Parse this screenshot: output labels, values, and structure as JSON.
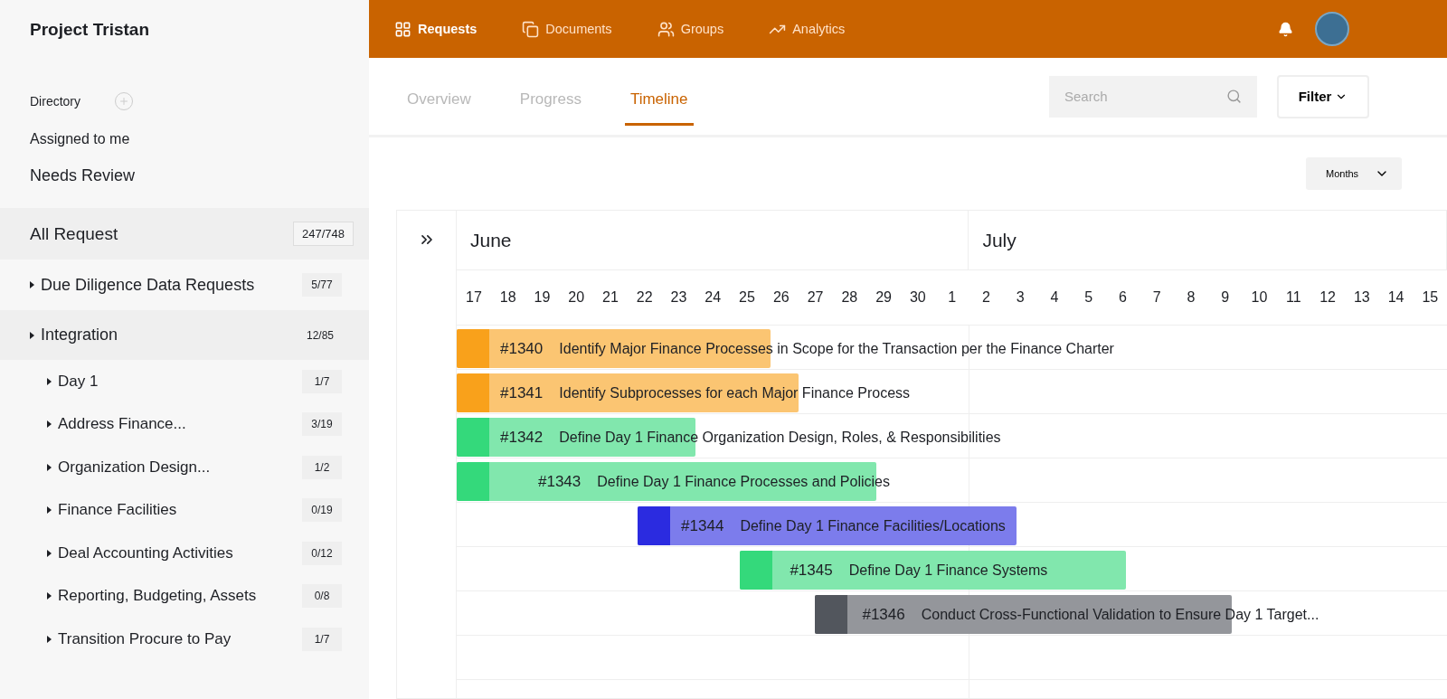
{
  "sidebar": {
    "title": "Project Tristan",
    "links": [
      {
        "label": "Directory",
        "kind": "section"
      },
      {
        "label": "Assigned to me",
        "kind": "link"
      },
      {
        "label": "Needs Review",
        "kind": "link-large"
      }
    ],
    "all_requests": {
      "label": "All Request",
      "count": "247/748"
    },
    "groups": [
      {
        "label": "Due Diligence Data Requests",
        "count": "5/77",
        "selected": false
      },
      {
        "label": "Integration",
        "count": "12/85",
        "selected": true,
        "children": [
          {
            "label": "Day 1",
            "count": "1/7"
          },
          {
            "label": "Address Finance...",
            "count": "3/19"
          },
          {
            "label": "Organization Design...",
            "count": "1/2"
          },
          {
            "label": "Finance Facilities",
            "count": "0/19"
          },
          {
            "label": "Deal Accounting Activities",
            "count": "0/12"
          },
          {
            "label": "Reporting, Budgeting, Assets",
            "count": "0/8"
          },
          {
            "label": "Transition Procure to Pay",
            "count": "1/7"
          }
        ]
      }
    ]
  },
  "top_nav": {
    "items": [
      {
        "label": "Requests",
        "selected": true
      },
      {
        "label": "Documents",
        "selected": false
      },
      {
        "label": "Groups",
        "selected": false
      },
      {
        "label": "Analytics",
        "selected": false
      }
    ]
  },
  "tabs": [
    {
      "label": "Overview",
      "selected": false
    },
    {
      "label": "Progress",
      "selected": false
    },
    {
      "label": "Timeline",
      "selected": true
    }
  ],
  "search": {
    "placeholder": "Search"
  },
  "filter_button": "Filter",
  "scale_select": "Months",
  "timeline": {
    "months": [
      {
        "name": "June",
        "days": [
          "17",
          "18",
          "19",
          "20",
          "21",
          "22",
          "23",
          "24",
          "25",
          "26",
          "27",
          "28",
          "29",
          "30",
          "1"
        ]
      },
      {
        "name": "July",
        "days": [
          "2",
          "3",
          "4",
          "5",
          "6",
          "7",
          "8",
          "9",
          "10",
          "11",
          "12",
          "13",
          "14",
          "15"
        ]
      }
    ],
    "tasks": [
      {
        "id": "#1340",
        "title": "Identify Major Finance Processes in Scope for the Transaction per the Finance Charter",
        "color": "#f9a11b"
      },
      {
        "id": "#1341",
        "title": "Identify Subprocesses for each Major Finance Process",
        "color": "#f9a11b"
      },
      {
        "id": "#1342",
        "title": "Define Day 1 Finance Organization Design, Roles, & Responsibilities",
        "color": "#34d97b"
      },
      {
        "id": "#1343",
        "title": "Define Day 1 Finance Processes and Policies",
        "color": "#34d97b"
      },
      {
        "id": "#1344",
        "title": "Define Day 1 Finance Facilities/Locations",
        "color": "#2b2be0"
      },
      {
        "id": "#1345",
        "title": "Define Day 1 Finance Systems",
        "color": "#34d97b"
      },
      {
        "id": "#1346",
        "title": "Conduct Cross-Functional Validation to Ensure Day 1 Target...",
        "color": "#52565d"
      }
    ]
  }
}
